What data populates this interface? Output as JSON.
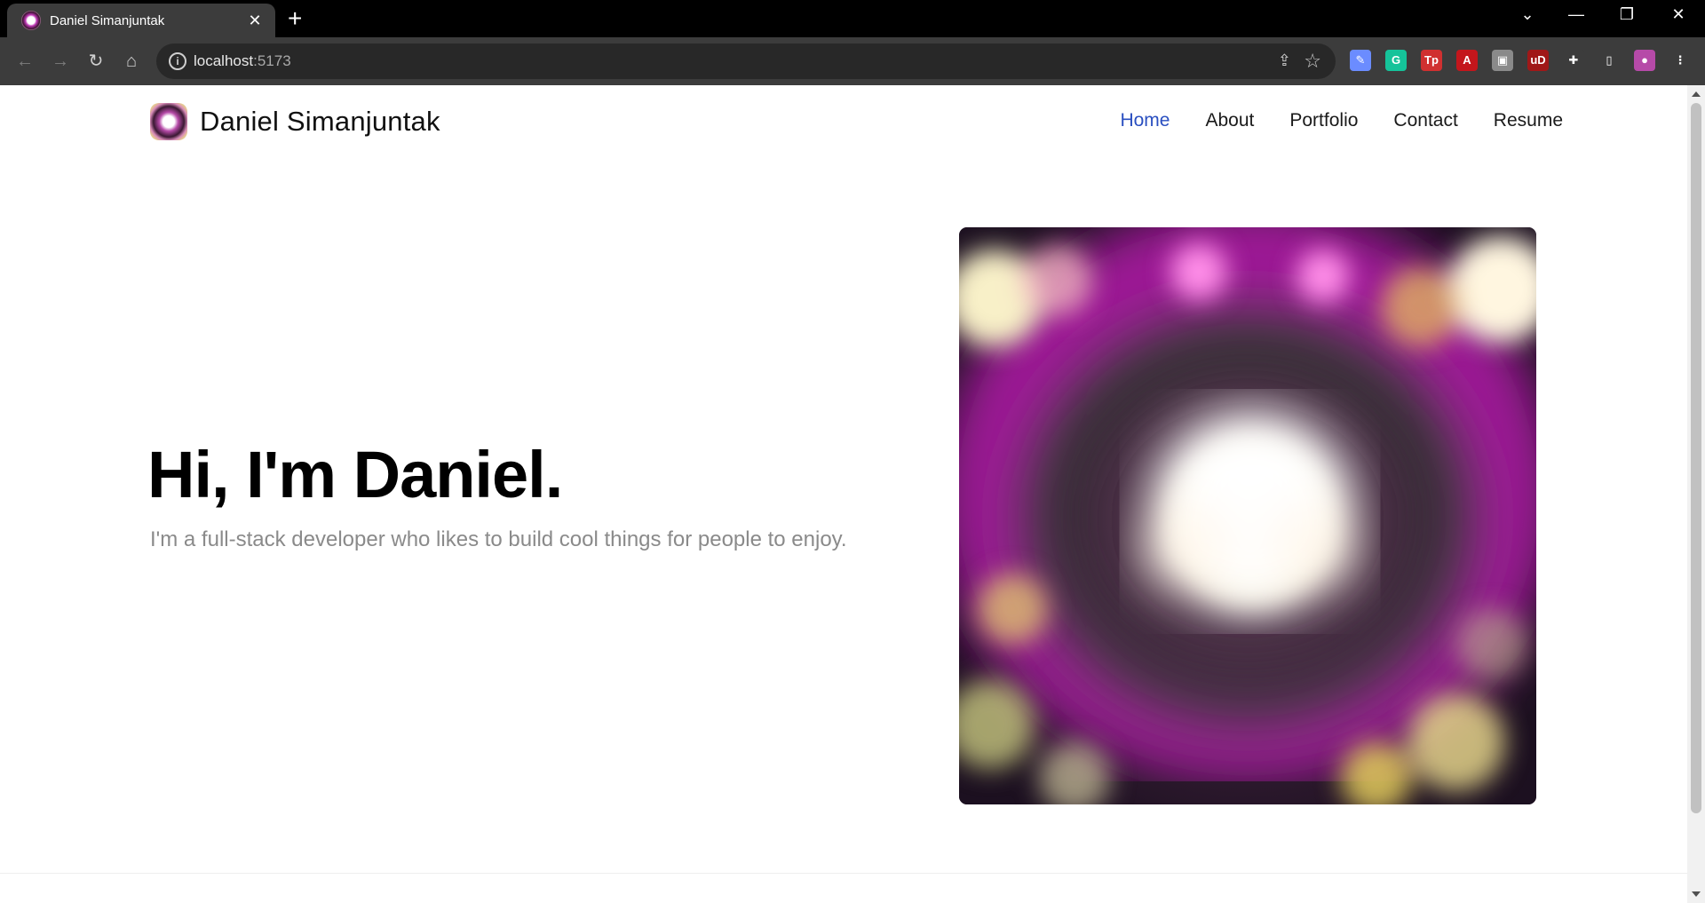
{
  "browser": {
    "tab_title": "Daniel Simanjuntak",
    "tab_close": "✕",
    "new_tab": "+",
    "url_host": "localhost",
    "url_port": ":5173",
    "window_controls": [
      "⌄",
      "—",
      "❐",
      "✕"
    ],
    "extensions": [
      {
        "name": "pen-extension-icon",
        "color": "#6b8cff",
        "glyph": "✎"
      },
      {
        "name": "grammarly-icon",
        "color": "#15c39a",
        "glyph": "G"
      },
      {
        "name": "tp-extension-icon",
        "color": "#d03030",
        "glyph": "Tp"
      },
      {
        "name": "acrobat-icon",
        "color": "#c4161c",
        "glyph": "A"
      },
      {
        "name": "gray-extension-icon",
        "color": "#8a8a8a",
        "glyph": "▣"
      },
      {
        "name": "ublock-icon",
        "color": "#a01818",
        "glyph": "uD"
      },
      {
        "name": "puzzle-extensions-icon",
        "color": "#3c3c3c",
        "glyph": "✚"
      },
      {
        "name": "side-panel-icon",
        "color": "#3c3c3c",
        "glyph": "▯"
      },
      {
        "name": "profile-avatar-icon",
        "color": "#b64aa8",
        "glyph": "●"
      },
      {
        "name": "kebab-menu-icon",
        "color": "#3c3c3c",
        "glyph": "⋮"
      }
    ]
  },
  "site": {
    "brand_name": "Daniel Simanjuntak",
    "nav": [
      {
        "label": "Home",
        "active": true
      },
      {
        "label": "About",
        "active": false
      },
      {
        "label": "Portfolio",
        "active": false
      },
      {
        "label": "Contact",
        "active": false
      },
      {
        "label": "Resume",
        "active": false
      }
    ],
    "hero_title": "Hi, I'm Daniel.",
    "hero_subtitle": "I'm a full-stack developer who likes to build cool things for people to enjoy."
  },
  "colors": {
    "nav_active": "#2a4fc0",
    "nav_default": "#1a1a1a",
    "subtitle": "#8a8a8a"
  }
}
